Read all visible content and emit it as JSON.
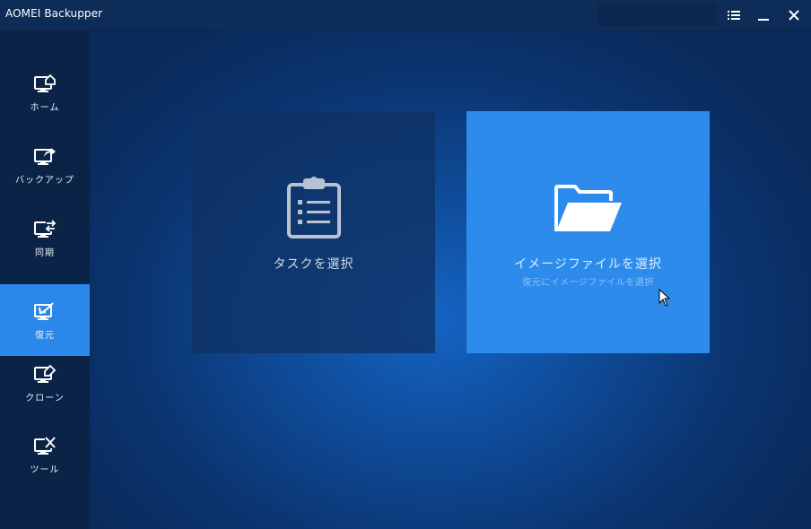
{
  "app": {
    "title": "AOMEI Backupper"
  },
  "window_controls": {
    "menu_icon": "list-icon",
    "minimize_icon": "minimize-icon",
    "close_icon": "close-icon"
  },
  "sidebar": {
    "items": [
      {
        "label": "ホーム",
        "icon": "home-icon",
        "active": false
      },
      {
        "label": "バックアップ",
        "icon": "backup-icon",
        "active": false
      },
      {
        "label": "同期",
        "icon": "sync-icon",
        "active": false
      },
      {
        "label": "復元",
        "icon": "restore-icon",
        "active": true
      },
      {
        "label": "クローン",
        "icon": "clone-icon",
        "active": false
      },
      {
        "label": "ツール",
        "icon": "tools-icon",
        "active": false
      }
    ]
  },
  "main": {
    "tiles": [
      {
        "title": "タスクを選択",
        "icon": "clipboard-icon"
      },
      {
        "title": "イメージファイルを選択",
        "subtitle": "復元にイメージファイルを選択",
        "icon": "folder-open-icon"
      }
    ]
  },
  "colors": {
    "accent": "#2d8ceb",
    "sidebar_bg": "#0b2347",
    "titlebar_bg": "#0d2d58"
  }
}
